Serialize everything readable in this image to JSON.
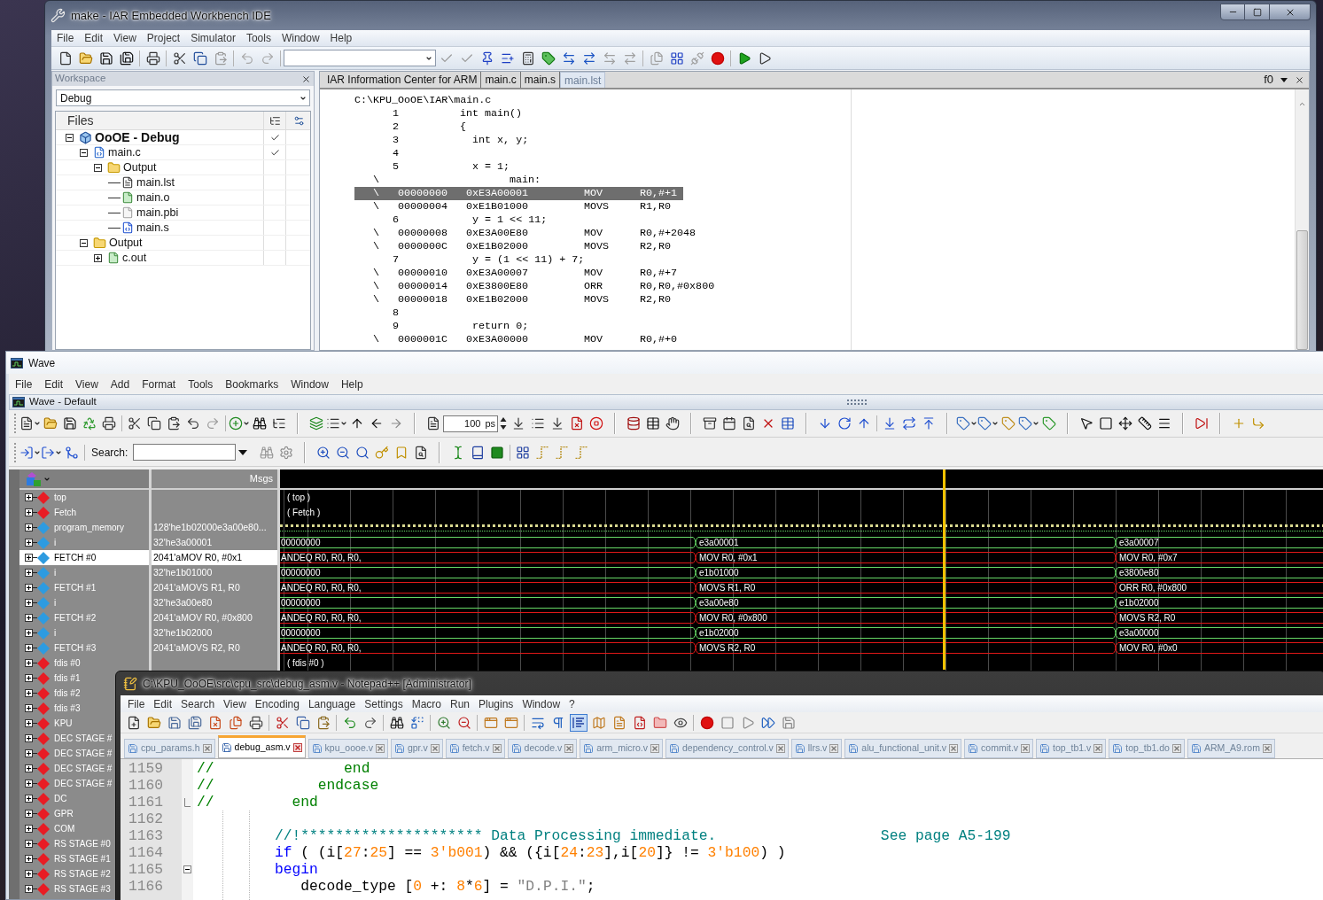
{
  "iar": {
    "title": "make - IAR Embedded Workbench IDE",
    "menu": [
      "File",
      "Edit",
      "View",
      "Project",
      "Simulator",
      "Tools",
      "Window",
      "Help"
    ],
    "workspace": {
      "title": "Workspace",
      "configuration": "Debug",
      "files_header": "Files",
      "tree": [
        {
          "label": "OoOE - Debug",
          "kind": "project",
          "checked": true,
          "expanded": true,
          "children": [
            {
              "label": "main.c",
              "kind": "c_file",
              "checked": true,
              "expanded": true,
              "children": [
                {
                  "label": "Output",
                  "kind": "folder",
                  "checked": false,
                  "expanded": true,
                  "children": [
                    {
                      "label": "main.lst",
                      "kind": "list_file",
                      "checked": false
                    },
                    {
                      "label": "main.o",
                      "kind": "object_file",
                      "checked": false
                    },
                    {
                      "label": "main.pbi",
                      "kind": "file",
                      "checked": false
                    },
                    {
                      "label": "main.s",
                      "kind": "asm_file",
                      "checked": false
                    }
                  ]
                }
              ]
            },
            {
              "label": "Output",
              "kind": "folder",
              "checked": false,
              "expanded": true,
              "children": [
                {
                  "label": "c.out",
                  "kind": "object_file",
                  "checked": false,
                  "expanded": false
                }
              ]
            }
          ]
        }
      ]
    },
    "editor": {
      "tabs": [
        {
          "label": "IAR Information Center for ARM",
          "selected": false
        },
        {
          "label": "main.c",
          "selected": false
        },
        {
          "label": "main.s",
          "selected": false
        },
        {
          "label": "main.lst",
          "selected": true
        }
      ],
      "function_box": "f0",
      "lines": [
        {
          "kind": "path",
          "text": "C:\\KPU_OoOE\\IAR\\main.c",
          "selected": false
        },
        {
          "kind": "source",
          "number": "1",
          "code": "int main()",
          "selected": false
        },
        {
          "kind": "source",
          "number": "2",
          "code": "{",
          "selected": false
        },
        {
          "kind": "source",
          "number": "3",
          "code": "  int x, y;",
          "selected": false
        },
        {
          "kind": "source",
          "number": "4",
          "selected": false
        },
        {
          "kind": "source",
          "number": "5",
          "code": "  x = 1;",
          "selected": false
        },
        {
          "kind": "label",
          "marker": "\\",
          "text": "main:",
          "selected": false
        },
        {
          "kind": "asm",
          "marker": "\\",
          "address": "00000000",
          "hex": "0xE3A00001",
          "mnemonic": "MOV",
          "operands": "R0,#+1",
          "selected": true
        },
        {
          "kind": "asm",
          "marker": "\\",
          "address": "00000004",
          "hex": "0xE1B01000",
          "mnemonic": "MOVS",
          "operands": "R1,R0",
          "selected": false
        },
        {
          "kind": "source",
          "number": "6",
          "code": "  y = 1 << 11;",
          "selected": false
        },
        {
          "kind": "asm",
          "marker": "\\",
          "address": "00000008",
          "hex": "0xE3A00E80",
          "mnemonic": "MOV",
          "operands": "R0,#+2048",
          "selected": false
        },
        {
          "kind": "asm",
          "marker": "\\",
          "address": "0000000C",
          "hex": "0xE1B02000",
          "mnemonic": "MOVS",
          "operands": "R2,R0",
          "selected": false
        },
        {
          "kind": "source",
          "number": "7",
          "code": "  y = (1 << 11) + 7;",
          "selected": false
        },
        {
          "kind": "asm",
          "marker": "\\",
          "address": "00000010",
          "hex": "0xE3A00007",
          "mnemonic": "MOV",
          "operands": "R0,#+7",
          "selected": false
        },
        {
          "kind": "asm",
          "marker": "\\",
          "address": "00000014",
          "hex": "0xE3800E80",
          "mnemonic": "ORR",
          "operands": "R0,R0,#0x800",
          "selected": false
        },
        {
          "kind": "asm",
          "marker": "\\",
          "address": "00000018",
          "hex": "0xE1B02000",
          "mnemonic": "MOVS",
          "operands": "R2,R0",
          "selected": false
        },
        {
          "kind": "source",
          "number": "8",
          "selected": false
        },
        {
          "kind": "source",
          "number": "9",
          "code": "  return 0;",
          "selected": false
        },
        {
          "kind": "asm",
          "marker": "\\",
          "address": "0000001C",
          "hex": "0xE3A00000",
          "mnemonic": "MOV",
          "operands": "R0,#+0",
          "selected": false
        }
      ]
    }
  },
  "wave": {
    "title": "Wave",
    "menu": [
      "File",
      "Edit",
      "View",
      "Add",
      "Format",
      "Tools",
      "Bookmarks",
      "Window",
      "Help"
    ],
    "pane_title": "Wave - Default",
    "time": {
      "value": "100",
      "unit": "ps"
    },
    "search_label": "Search:",
    "values_header": "Msgs",
    "signals": [
      {
        "name": "top",
        "color": "#e81c24",
        "selected": false,
        "wave": {
          "kind": "label",
          "text": "( top )"
        }
      },
      {
        "name": "Fetch",
        "color": "#e81c24",
        "selected": false,
        "wave": {
          "kind": "label",
          "text": "( Fetch )"
        }
      },
      {
        "name": "program_memory",
        "color": "#2d9be0",
        "selected": false,
        "value": "128'he1b02000e3a00e80...",
        "wave": {
          "kind": "pattern"
        }
      },
      {
        "name": "i",
        "color": "#2d9be0",
        "selected": false,
        "value": "32'he3a00001",
        "wave": {
          "kind": "bus",
          "color": "#66d966",
          "segments": [
            "00000000",
            "e3a00001",
            "e3a00007"
          ]
        }
      },
      {
        "name": "FETCH #0",
        "color": "#2d9be0",
        "selected": true,
        "value": "2041'aMOV R0, #0x1",
        "wave": {
          "kind": "bus",
          "color": "#e01818",
          "segments": [
            "ANDEQ R0, R0, R0,",
            "MOV R0, #0x1",
            "MOV R0, #0x7"
          ]
        }
      },
      {
        "name": "i",
        "color": "#2d9be0",
        "selected": false,
        "value": "32'he1b01000",
        "wave": {
          "kind": "bus",
          "color": "#66d966",
          "segments": [
            "00000000",
            "e1b01000",
            "e3800e80"
          ]
        }
      },
      {
        "name": "FETCH #1",
        "color": "#2d9be0",
        "selected": false,
        "value": "2041'aMOVS R1, R0",
        "wave": {
          "kind": "bus",
          "color": "#e01818",
          "segments": [
            "ANDEQ R0, R0, R0,",
            "MOVS R1, R0",
            "ORR R0, #0x800"
          ]
        }
      },
      {
        "name": "i",
        "color": "#2d9be0",
        "selected": false,
        "value": "32'he3a00e80",
        "wave": {
          "kind": "bus",
          "color": "#66d966",
          "segments": [
            "00000000",
            "e3a00e80",
            "e1b02000"
          ]
        }
      },
      {
        "name": "FETCH #2",
        "color": "#2d9be0",
        "selected": false,
        "value": "2041'aMOV R0, #0x800",
        "wave": {
          "kind": "bus",
          "color": "#e01818",
          "segments": [
            "ANDEQ R0, R0, R0,",
            "MOV R0, #0x800",
            "MOVS R2, R0"
          ]
        }
      },
      {
        "name": "i",
        "color": "#2d9be0",
        "selected": false,
        "value": "32'he1b02000",
        "wave": {
          "kind": "bus",
          "color": "#66d966",
          "segments": [
            "00000000",
            "e1b02000",
            "e3a00000"
          ]
        }
      },
      {
        "name": "FETCH #3",
        "color": "#2d9be0",
        "selected": false,
        "value": "2041'aMOVS R2, R0",
        "wave": {
          "kind": "bus",
          "color": "#e01818",
          "segments": [
            "ANDEQ R0, R0, R0,",
            "MOVS R2, R0",
            "MOV R0, #0x0"
          ]
        }
      },
      {
        "name": "fdis #0",
        "color": "#e81c24",
        "selected": false,
        "wave": {
          "kind": "label",
          "text": "( fdis #0 )"
        }
      },
      {
        "name": "fdis #1",
        "color": "#e81c24",
        "selected": false
      },
      {
        "name": "fdis #2",
        "color": "#e81c24",
        "selected": false
      },
      {
        "name": "fdis #3",
        "color": "#e81c24",
        "selected": false
      },
      {
        "name": "KPU",
        "color": "#e81c24",
        "selected": false
      },
      {
        "name": "DEC STAGE #",
        "color": "#e81c24",
        "selected": false
      },
      {
        "name": "DEC STAGE #",
        "color": "#e81c24",
        "selected": false
      },
      {
        "name": "DEC STAGE #",
        "color": "#e81c24",
        "selected": false
      },
      {
        "name": "DEC STAGE #",
        "color": "#e81c24",
        "selected": false
      },
      {
        "name": "DC",
        "color": "#e81c24",
        "selected": false
      },
      {
        "name": "GPR",
        "color": "#e81c24",
        "selected": false
      },
      {
        "name": "COM",
        "color": "#e81c24",
        "selected": false
      },
      {
        "name": "RS STAGE #0",
        "color": "#e81c24",
        "selected": false
      },
      {
        "name": "RS STAGE #1",
        "color": "#e81c24",
        "selected": false
      },
      {
        "name": "RS STAGE #2",
        "color": "#e81c24",
        "selected": false
      },
      {
        "name": "RS STAGE #3",
        "color": "#e81c24",
        "selected": false
      }
    ]
  },
  "notepad": {
    "title": "C:\\KPU_OoOE\\src\\cpu_src\\debug_asm.v - Notepad++ [Administrator]",
    "menu": [
      "File",
      "Edit",
      "Search",
      "View",
      "Encoding",
      "Language",
      "Settings",
      "Macro",
      "Run",
      "Plugins",
      "Window",
      "?"
    ],
    "indent_guide_on": true,
    "tabs": [
      {
        "label": "cpu_params.h",
        "selected": false
      },
      {
        "label": "debug_asm.v",
        "selected": true
      },
      {
        "label": "kpu_oooe.v",
        "selected": false
      },
      {
        "label": "gpr.v",
        "selected": false
      },
      {
        "label": "fetch.v",
        "selected": false
      },
      {
        "label": "decode.v",
        "selected": false
      },
      {
        "label": "arm_micro.v",
        "selected": false
      },
      {
        "label": "dependency_control.v",
        "selected": false
      },
      {
        "label": "llrs.v",
        "selected": false
      },
      {
        "label": "alu_functional_unit.v",
        "selected": false
      },
      {
        "label": "commit.v",
        "selected": false
      },
      {
        "label": "top_tb1.v",
        "selected": false
      },
      {
        "label": "top_tb1.do",
        "selected": false
      },
      {
        "label": "ARM_A9.rom",
        "selected": false
      }
    ],
    "lines": [
      {
        "number": "1159",
        "fold_end": false,
        "tokens": [
          {
            "kind": "comment",
            "text": "//               end"
          }
        ]
      },
      {
        "number": "1160",
        "fold_end": false,
        "tokens": [
          {
            "kind": "comment",
            "text": "//            endcase"
          }
        ]
      },
      {
        "number": "1161",
        "fold_end": true,
        "tokens": [
          {
            "kind": "comment",
            "text": "//         end"
          }
        ]
      },
      {
        "number": "1162",
        "fold_end": false
      },
      {
        "number": "1163",
        "fold_end": false,
        "tokens": [
          {
            "kind": "doc_comment",
            "text": "         //!********************* Data Processing immediate.                   See page A5-199"
          }
        ]
      },
      {
        "number": "1164",
        "fold_end": false,
        "tokens": [
          {
            "kind": "keyword",
            "text": "         if"
          },
          {
            "kind": "plain",
            "text": " ( (i["
          },
          {
            "kind": "number",
            "text": "27"
          },
          {
            "kind": "plain",
            "text": ":"
          },
          {
            "kind": "number",
            "text": "25"
          },
          {
            "kind": "plain",
            "text": "] == "
          },
          {
            "kind": "number",
            "text": "3'b001"
          },
          {
            "kind": "plain",
            "text": ") && ({i["
          },
          {
            "kind": "number",
            "text": "24"
          },
          {
            "kind": "plain",
            "text": ":"
          },
          {
            "kind": "number",
            "text": "23"
          },
          {
            "kind": "plain",
            "text": "],i["
          },
          {
            "kind": "number",
            "text": "20"
          },
          {
            "kind": "plain",
            "text": "]} != "
          },
          {
            "kind": "number",
            "text": "3'b100"
          },
          {
            "kind": "plain",
            "text": ") )"
          }
        ]
      },
      {
        "number": "1165",
        "fold_end": false,
        "expanded": true,
        "tokens": [
          {
            "kind": "keyword",
            "text": "         begin"
          }
        ]
      },
      {
        "number": "1166",
        "fold_end": false,
        "tokens": [
          {
            "kind": "plain",
            "text": "            decode_type ["
          },
          {
            "kind": "number",
            "text": "0"
          },
          {
            "kind": "plain",
            "text": " +: "
          },
          {
            "kind": "number",
            "text": "8"
          },
          {
            "kind": "plain",
            "text": "*"
          },
          {
            "kind": "number",
            "text": "6"
          },
          {
            "kind": "plain",
            "text": "] = "
          },
          {
            "kind": "string",
            "text": "\"D.P.I.\""
          },
          {
            "kind": "plain",
            "text": ";"
          }
        ]
      }
    ]
  }
}
